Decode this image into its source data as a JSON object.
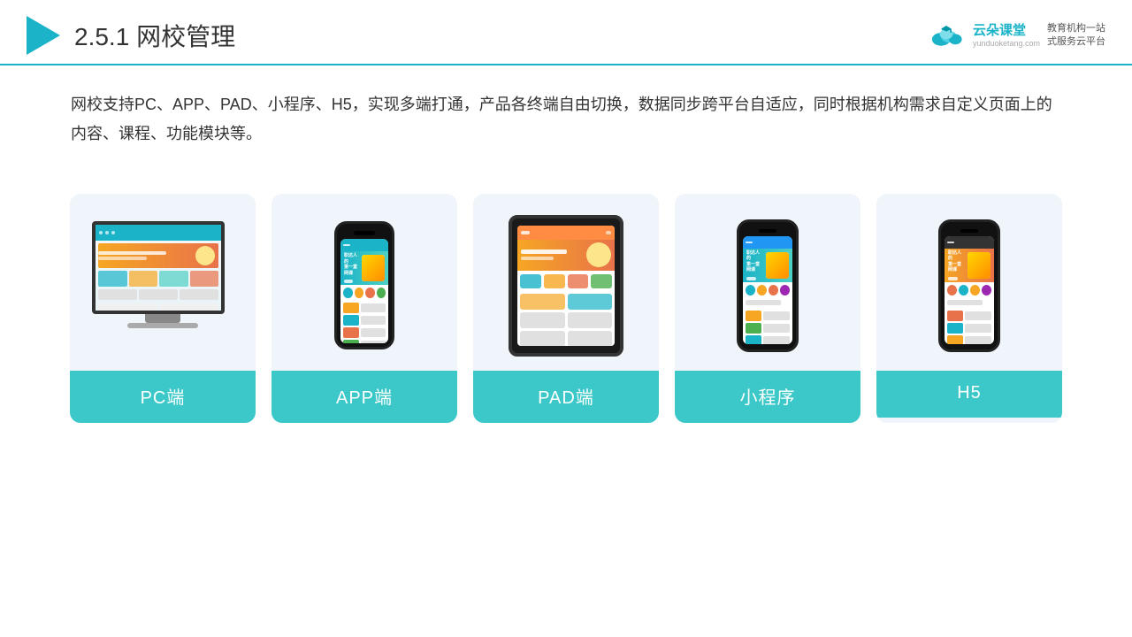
{
  "header": {
    "title_number": "2.5.1",
    "title_text": "网校管理",
    "logo_name": "云朵课堂",
    "logo_url": "yunduoketang.com",
    "logo_slogan": "教育机构一站\n式服务云平台"
  },
  "description": {
    "text": "网校支持PC、APP、PAD、小程序、H5，实现多端打通，产品各终端自由切换，数据同步跨平台自适应，同时根据机构需求自定义页面上的内容、课程、功能模块等。"
  },
  "cards": [
    {
      "id": "pc",
      "label": "PC端"
    },
    {
      "id": "app",
      "label": "APP端"
    },
    {
      "id": "pad",
      "label": "PAD端"
    },
    {
      "id": "miniapp",
      "label": "小程序"
    },
    {
      "id": "h5",
      "label": "H5"
    }
  ],
  "colors": {
    "teal": "#3cc8c8",
    "accent": "#1ab3c8",
    "card_bg": "#eef3fa"
  }
}
